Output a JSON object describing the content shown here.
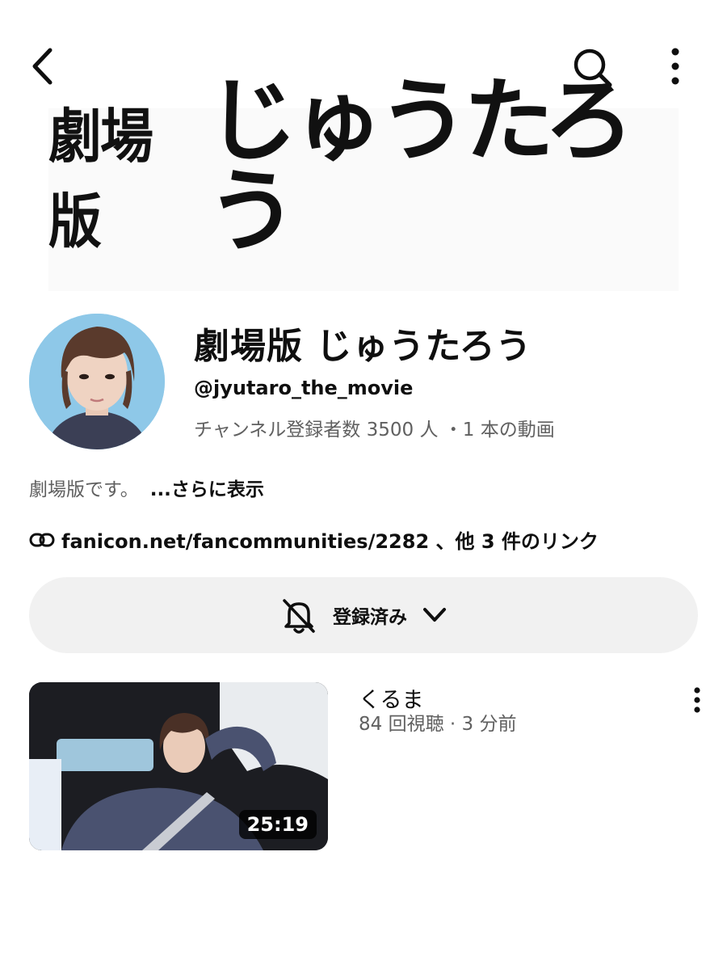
{
  "header": {
    "back_icon": "chevron-left-icon",
    "search_icon": "search-icon",
    "more_icon": "more-vertical-icon"
  },
  "banner": {
    "small_text": "劇場版",
    "big_text": "じゅうたろう"
  },
  "channel": {
    "name": "劇場版 じゅうたろう",
    "handle": "@jyutaro_the_movie",
    "stats": "チャンネル登録者数 3500 人 ・1 本の動画",
    "description": "劇場版です。",
    "more_label": "...さらに表示",
    "link_text": "fanicon.net/fancommunities/2282 、他 3 件のリンク",
    "avatar_bg": "#8ec8e8"
  },
  "subscribe": {
    "label": "登録済み",
    "bell_icon": "bell-off-icon",
    "chevron_icon": "chevron-down-icon"
  },
  "videos": [
    {
      "title": "くるま",
      "meta": "84 回視聴 · 3 分前",
      "duration": "25:19"
    }
  ]
}
